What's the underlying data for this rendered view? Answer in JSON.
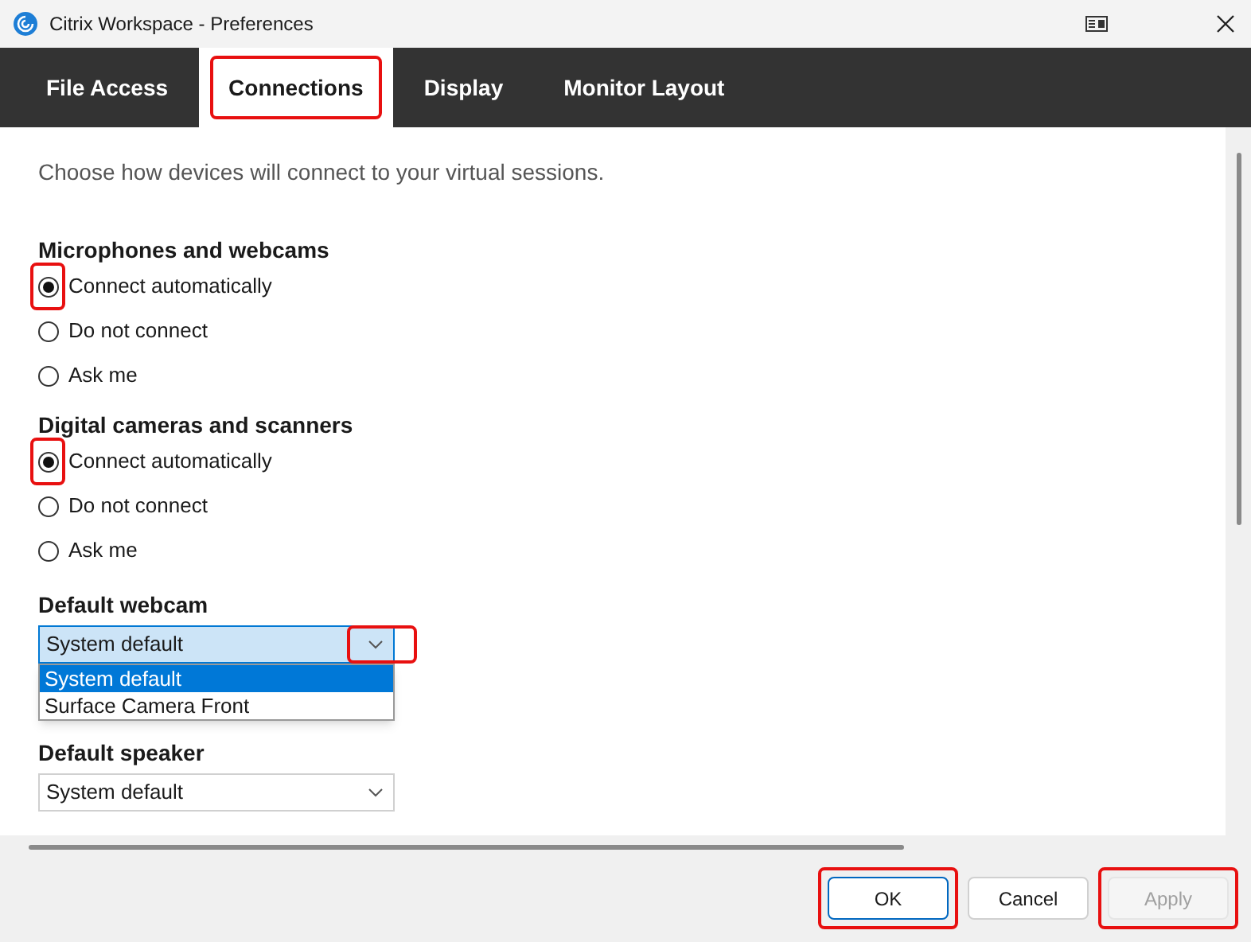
{
  "window": {
    "title": "Citrix Workspace - Preferences"
  },
  "tabs": [
    {
      "label": "File Access",
      "selected": false,
      "highlighted": false
    },
    {
      "label": "Connections",
      "selected": true,
      "highlighted": true
    },
    {
      "label": "Display",
      "selected": false,
      "highlighted": false
    },
    {
      "label": "Monitor Layout",
      "selected": false,
      "highlighted": false
    }
  ],
  "intro": "Choose how devices will connect to your virtual sessions.",
  "groups": [
    {
      "heading": "Microphones and webcams",
      "options": [
        {
          "label": "Connect automatically",
          "selected": true,
          "highlighted": true
        },
        {
          "label": "Do not connect",
          "selected": false,
          "highlighted": false
        },
        {
          "label": "Ask me",
          "selected": false,
          "highlighted": false
        }
      ]
    },
    {
      "heading": "Digital cameras and scanners",
      "options": [
        {
          "label": "Connect automatically",
          "selected": true,
          "highlighted": true
        },
        {
          "label": "Do not connect",
          "selected": false,
          "highlighted": false
        },
        {
          "label": "Ask me",
          "selected": false,
          "highlighted": false
        }
      ]
    }
  ],
  "selects": [
    {
      "label": "Default webcam",
      "value": "System default",
      "expanded": true,
      "highlighted": true,
      "options": [
        {
          "label": "System default",
          "selected": true
        },
        {
          "label": "Surface Camera Front",
          "selected": false
        }
      ]
    },
    {
      "label": "Default speaker",
      "value": "System default",
      "expanded": false,
      "highlighted": false
    }
  ],
  "buttons": [
    {
      "label": "OK",
      "kind": "primary",
      "disabled": false,
      "highlighted": true
    },
    {
      "label": "Cancel",
      "kind": "normal",
      "disabled": false,
      "highlighted": false
    },
    {
      "label": "Apply",
      "kind": "normal",
      "disabled": true,
      "highlighted": true
    }
  ]
}
